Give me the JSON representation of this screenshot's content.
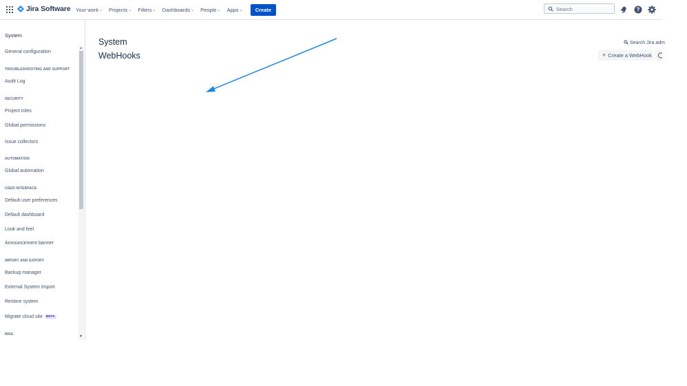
{
  "topbar": {
    "logo_text": "Jira Software",
    "nav": [
      {
        "label": "Your work"
      },
      {
        "label": "Projects"
      },
      {
        "label": "Filters"
      },
      {
        "label": "Dashboards"
      },
      {
        "label": "People"
      },
      {
        "label": "Apps"
      }
    ],
    "create_label": "Create",
    "search_placeholder": "Search",
    "icons": [
      "app-switcher-icon",
      "notifications-icon",
      "help-icon",
      "settings-icon"
    ]
  },
  "sidebar": {
    "title": "System",
    "items": [
      {
        "type": "item",
        "label": "General configuration"
      },
      {
        "type": "header",
        "label": "TROUBLESHOOTING AND SUPPORT"
      },
      {
        "type": "item",
        "label": "Audit Log"
      },
      {
        "type": "header",
        "label": "SECURITY"
      },
      {
        "type": "item",
        "label": "Project roles"
      },
      {
        "type": "item",
        "label": "Global permissions"
      },
      {
        "type": "item",
        "label": "Issue collectors"
      },
      {
        "type": "header",
        "label": "AUTOMATION"
      },
      {
        "type": "item",
        "label": "Global automation"
      },
      {
        "type": "header",
        "label": "USER INTERFACE"
      },
      {
        "type": "item",
        "label": "Default user preferences"
      },
      {
        "type": "item",
        "label": "Default dashboard"
      },
      {
        "type": "item",
        "label": "Look and feel"
      },
      {
        "type": "item",
        "label": "Announcement banner"
      },
      {
        "type": "header",
        "label": "IMPORT AND EXPORT"
      },
      {
        "type": "item",
        "label": "Backup manager"
      },
      {
        "type": "item",
        "label": "External System Import"
      },
      {
        "type": "item",
        "label": "Restore system"
      },
      {
        "type": "item",
        "label": "Migrate cloud site",
        "badge": "BETA"
      },
      {
        "type": "header",
        "label": "MAIL"
      }
    ]
  },
  "main": {
    "section": "System",
    "title": "WebHooks",
    "search_admin": "Search Jira adm",
    "create_webhook": "Create a WebHook"
  },
  "colors": {
    "brand": "#0052cc",
    "annotation_arrow": "#1e88e5",
    "text": "#172b4d"
  }
}
